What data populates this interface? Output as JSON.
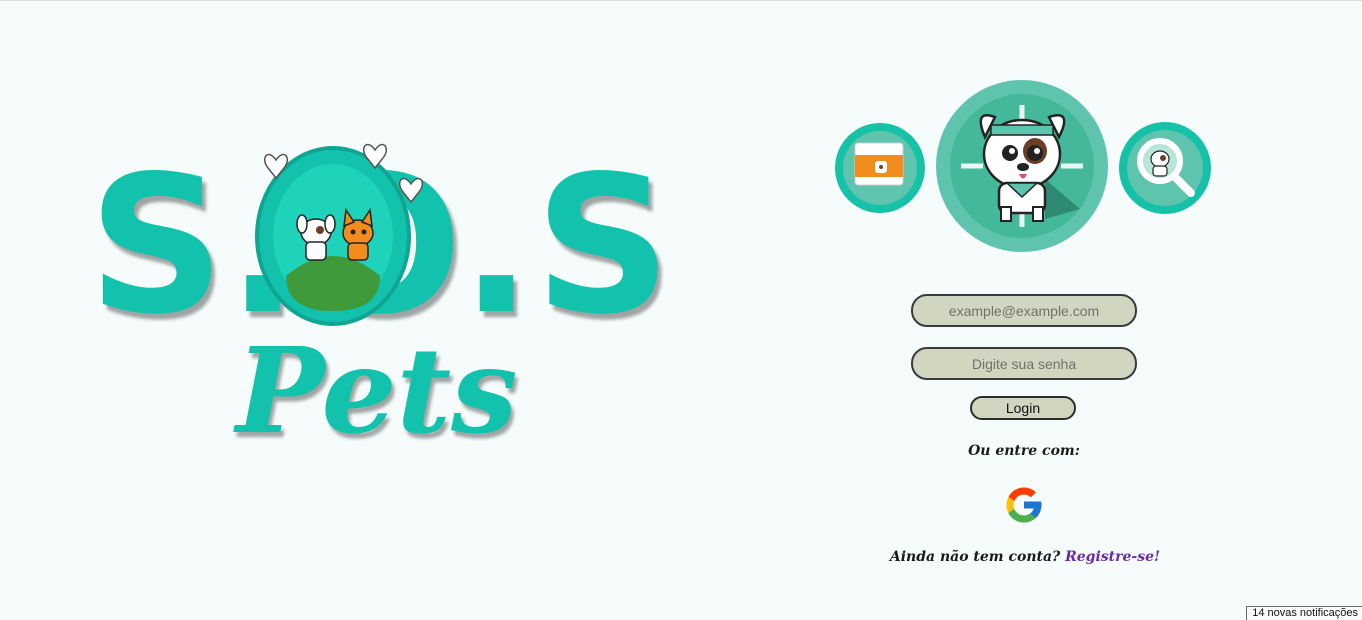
{
  "logo": {
    "sos_text": "S.O.S",
    "pets_text": "Pets",
    "colors": {
      "primary": "#13c2ac",
      "hill": "#3e9a3a",
      "heart": "#ffffff"
    }
  },
  "avatars": [
    {
      "icon": "report-screen-dog-icon"
    },
    {
      "icon": "hero-dog-mascot-icon"
    },
    {
      "icon": "magnifier-dog-search-icon"
    }
  ],
  "login_form": {
    "email_placeholder": "example@example.com",
    "email_value": "",
    "password_placeholder": "Digite sua senha",
    "password_value": "",
    "login_label": "Login",
    "alt_login_label": "Ou entre com:",
    "google_icon": "google-icon",
    "no_account_text": "Ainda não tem conta? ",
    "register_link": "Registre-se!"
  },
  "notifications": {
    "toast_text": "14 novas notificações"
  },
  "colors": {
    "background": "#f5fcfb",
    "field_bg": "#d1d6c1",
    "link": "#6a2aa8",
    "teal_circle": "#5fc4ad"
  }
}
